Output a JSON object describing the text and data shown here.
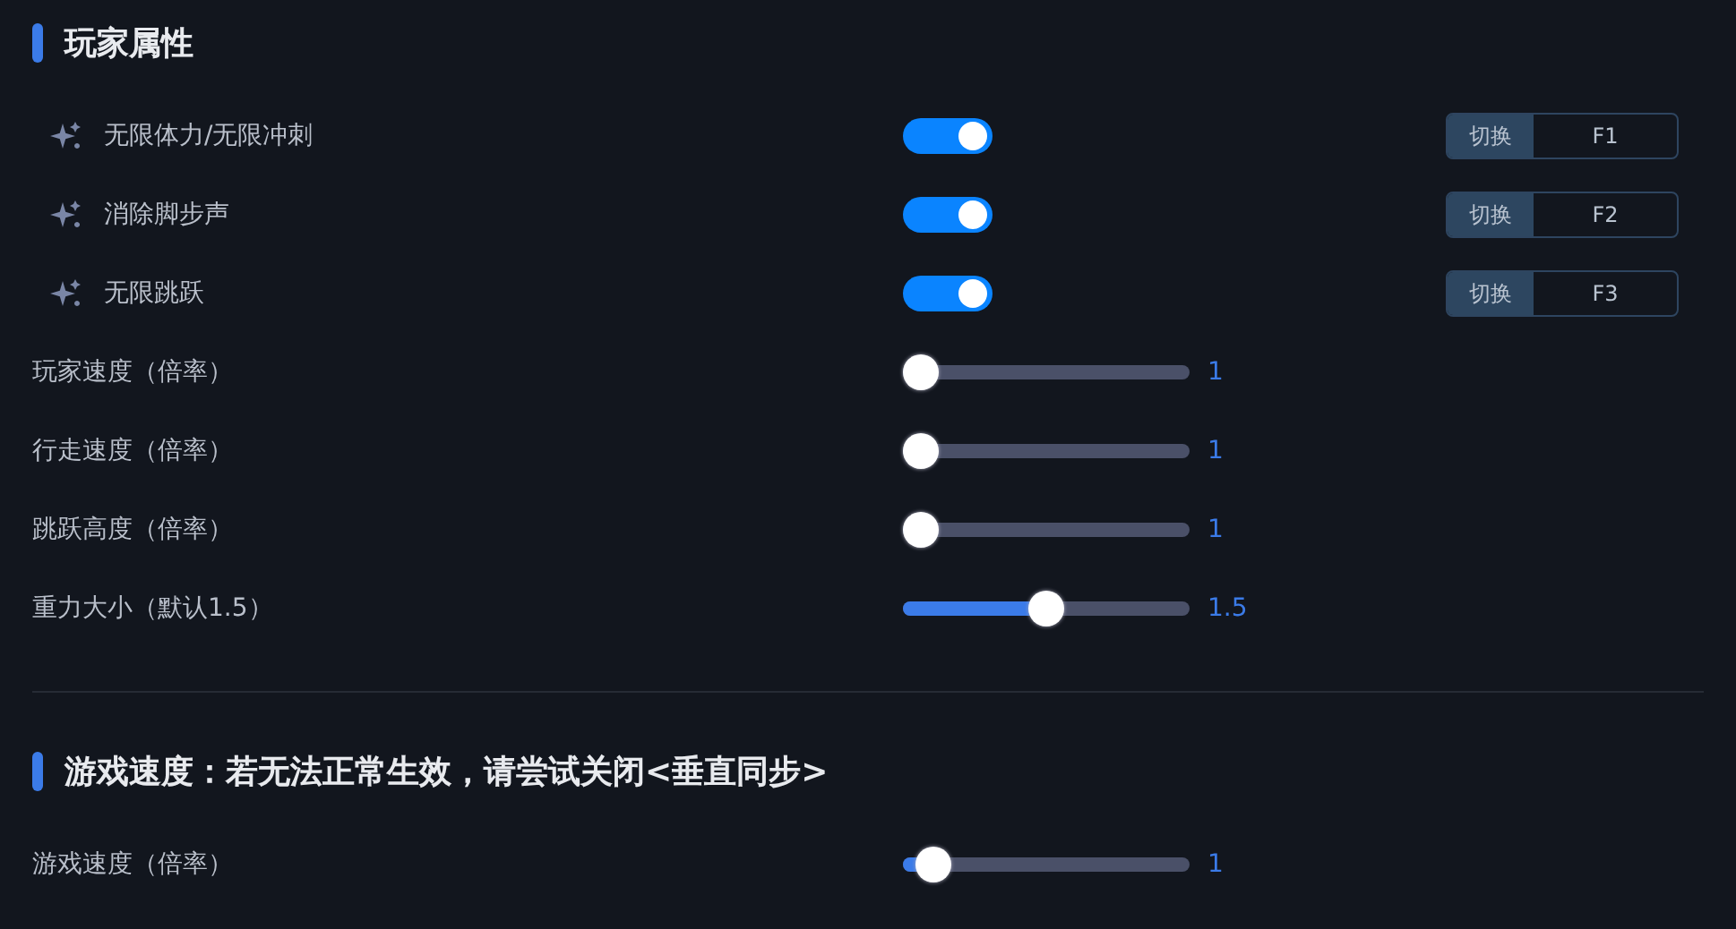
{
  "sections": [
    {
      "title": "玩家属性",
      "rows": [
        {
          "kind": "toggle",
          "label": "无限体力/无限冲刺",
          "on": true,
          "hotkey_label": "切换",
          "hotkey": "F1"
        },
        {
          "kind": "toggle",
          "label": "消除脚步声",
          "on": true,
          "hotkey_label": "切换",
          "hotkey": "F2"
        },
        {
          "kind": "toggle",
          "label": "无限跳跃",
          "on": true,
          "hotkey_label": "切换",
          "hotkey": "F3"
        },
        {
          "kind": "slider",
          "label": "玩家速度（倍率）",
          "level": 0,
          "value": "1"
        },
        {
          "kind": "slider",
          "label": "行走速度（倍率）",
          "level": 0,
          "value": "1"
        },
        {
          "kind": "slider",
          "label": "跳跃高度（倍率）",
          "level": 0,
          "value": "1"
        },
        {
          "kind": "slider",
          "label": "重力大小（默认1.5）",
          "level": 0.5,
          "value": "1.5"
        }
      ]
    },
    {
      "title": "游戏速度：若无法正常生效，请尝试关闭<垂直同步>",
      "rows": [
        {
          "kind": "slider",
          "label": "游戏速度（倍率）",
          "level": 0.05,
          "value": "1"
        }
      ]
    }
  ]
}
